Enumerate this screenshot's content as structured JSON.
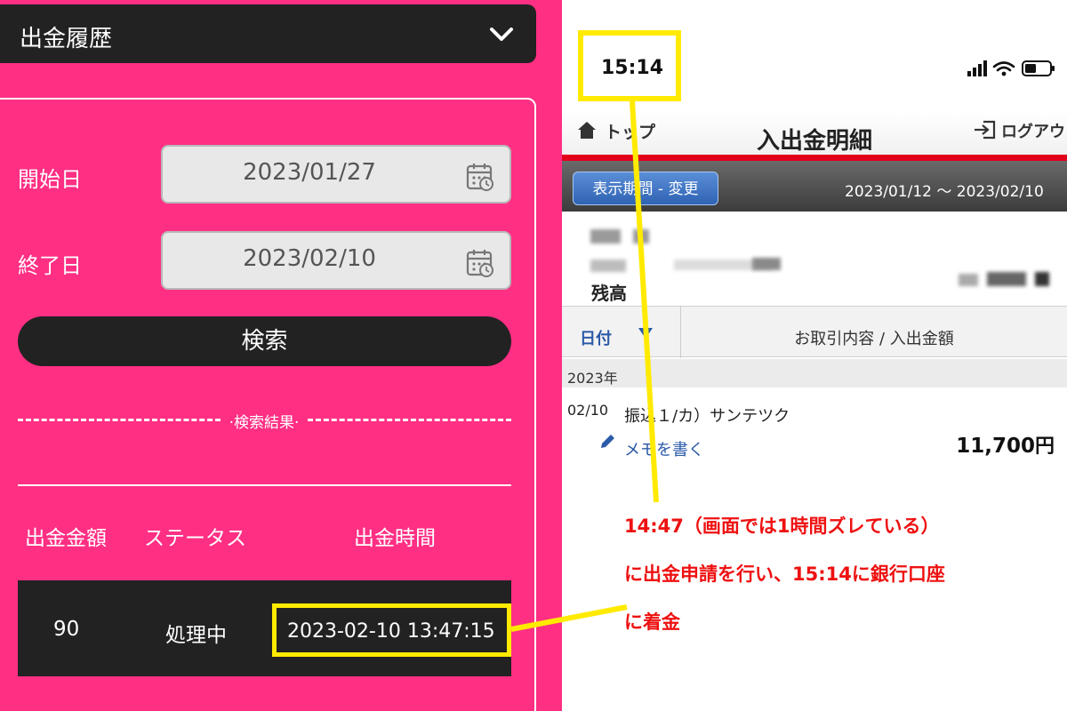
{
  "left_panel": {
    "header_title": "出金履歴",
    "start_label": "開始日",
    "start_value": "2023/01/27",
    "end_label": "終了日",
    "end_value": "2023/02/10",
    "search_button": "検索",
    "results_label": "·検索結果·",
    "columns": [
      "出金金額",
      "ステータス",
      "出金時間"
    ],
    "row": {
      "amount": "90",
      "status": "処理中",
      "time": "2023-02-10 13:47:15"
    },
    "colors": {
      "background": "#ff2f84",
      "dark": "#222222",
      "highlight": "#ffea00"
    }
  },
  "right_panel": {
    "status_time": "15:14",
    "nav": {
      "top_label": "トップ",
      "title": "入出金明細",
      "logout_label": "ログアウト"
    },
    "period_button": "表示期間 - 変更",
    "period_range": "2023/01/12 ～ 2023/02/10",
    "balance_label": "残高",
    "table_headers": {
      "date": "日付",
      "content": "お取引内容 / 入出金額"
    },
    "year": "2023年",
    "transaction": {
      "date": "02/10",
      "description": "振込１/カ）サンテツク",
      "memo": "メモを書く",
      "amount": "11,700",
      "currency": "円"
    },
    "colors": {
      "accent_red": "#e3001b",
      "link_blue": "#2b5aa8"
    }
  },
  "annotation": {
    "lines": [
      "14:47（画面では1時間ズレている）",
      "に出金申請を行い、15:14に銀行口座",
      "に着金"
    ],
    "color": "#ee1111"
  }
}
